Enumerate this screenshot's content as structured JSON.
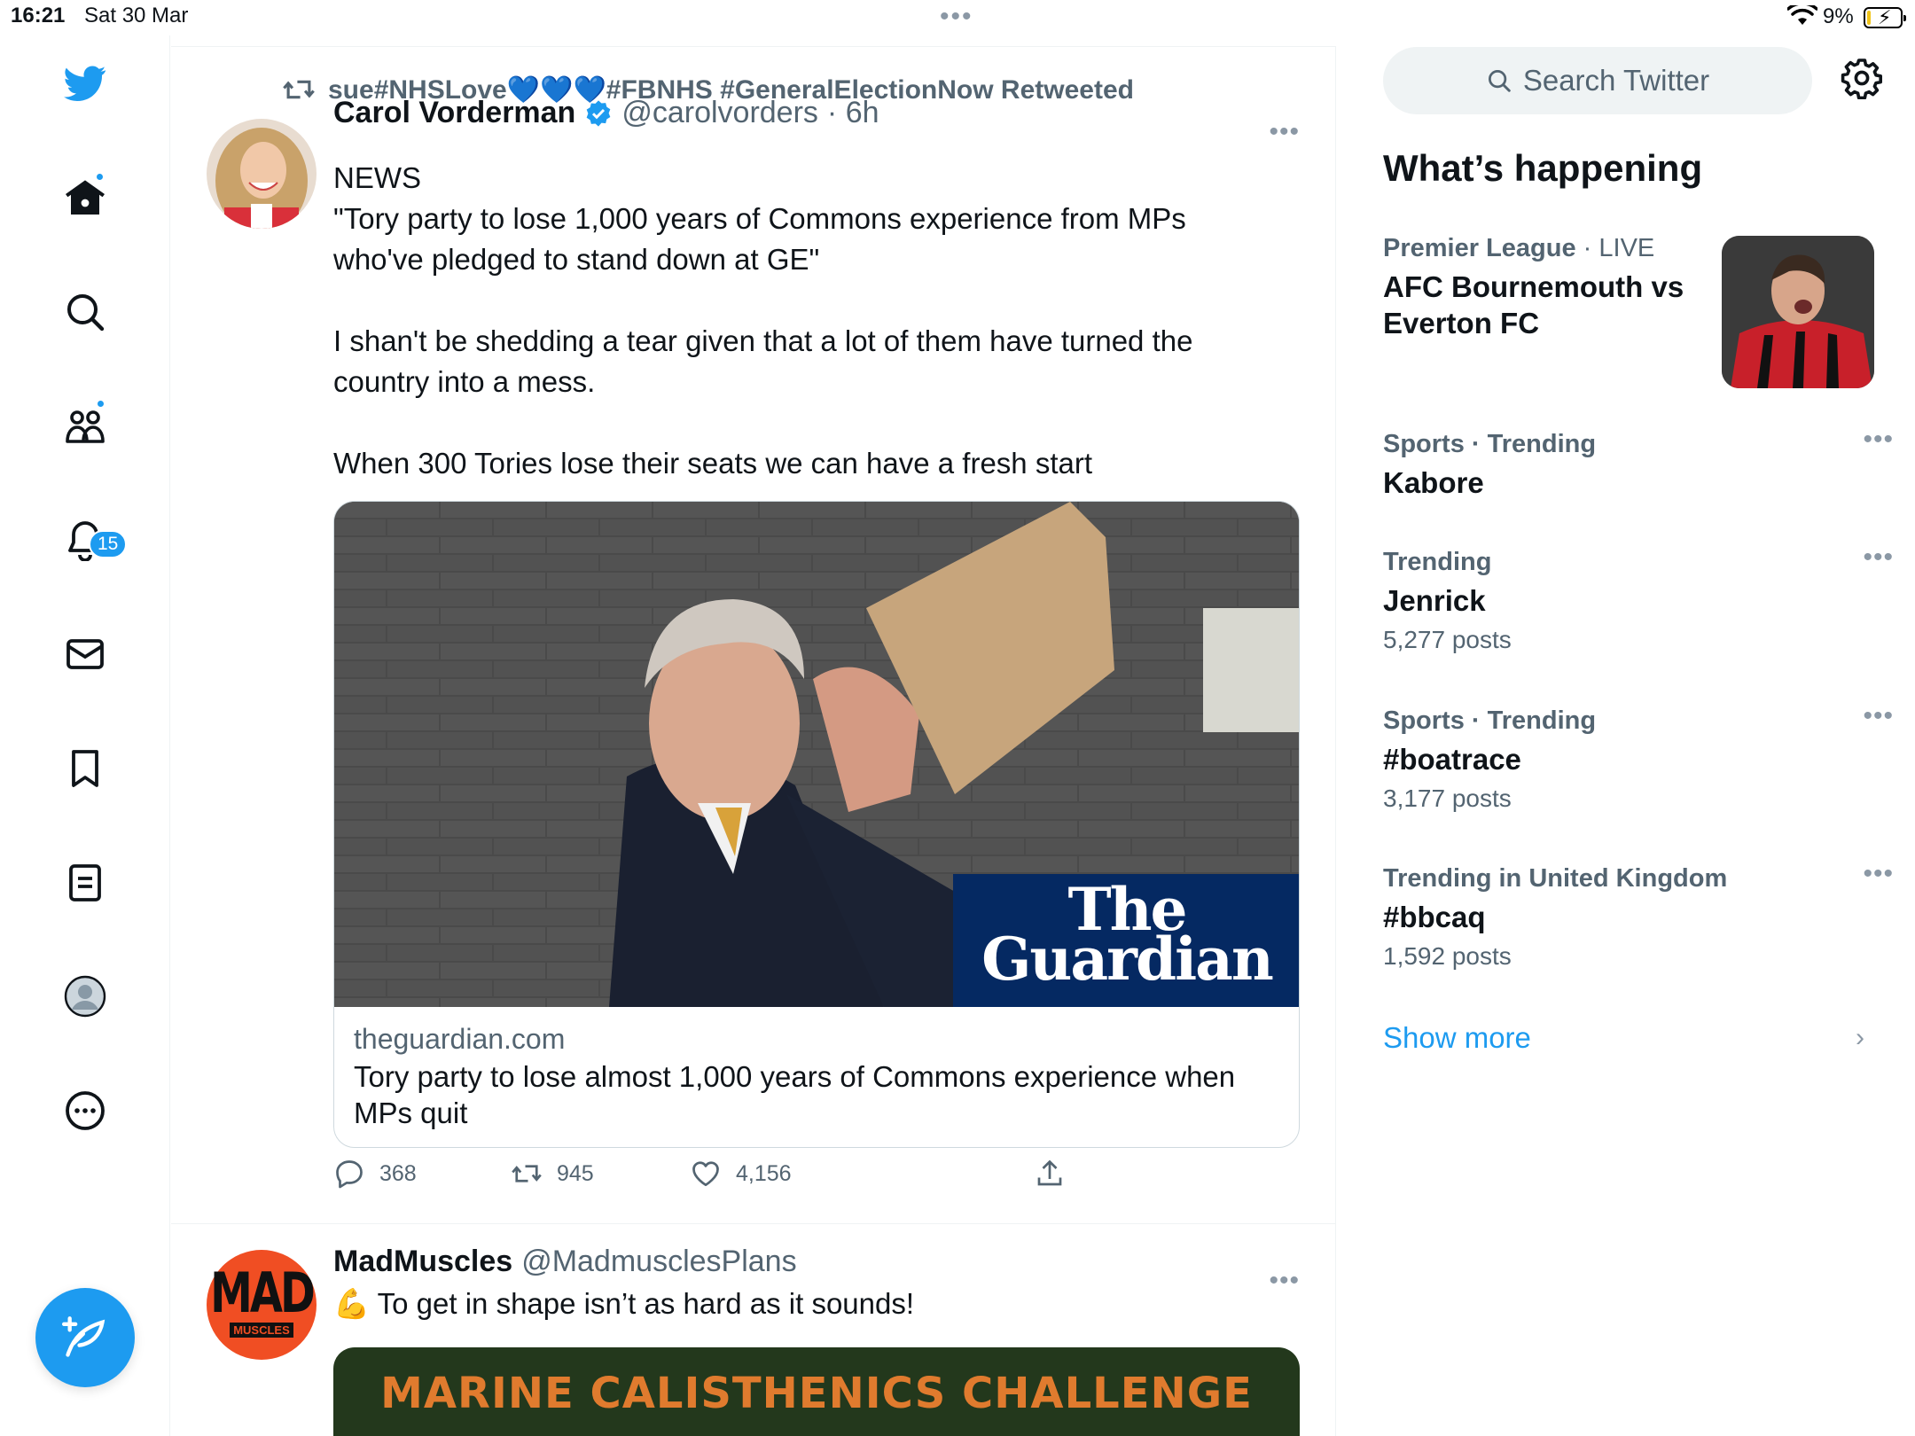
{
  "status_bar": {
    "time": "16:21",
    "date": "Sat 30 Mar",
    "battery_percent": "9%",
    "battery_level": 0.09
  },
  "nav": {
    "items": [
      "home",
      "explore",
      "communities",
      "notifications",
      "messages",
      "bookmarks",
      "lists",
      "profile",
      "more"
    ],
    "notifications_badge": "15"
  },
  "tweets": [
    {
      "retweeted_by": "sue#NHSLove💙💙💙#FBNHS #GeneralElectionNow Retweeted",
      "name": "Carol Vorderman",
      "handle": "@carolvorders",
      "time": "· 6h",
      "text": "NEWS\n\"Tory party to lose 1,000 years of Commons experience from MPs who've pledged to stand down at GE\"\n\nI shan't be shedding a tear given that a lot of them have turned the country into a mess.\n\nWhen 300 Tories lose their seats we can have a fresh start",
      "card": {
        "image_logo_line1": "The",
        "image_logo_line2": "Guardian",
        "domain": "theguardian.com",
        "title": "Tory party to lose almost 1,000 years of Commons experience when MPs quit"
      },
      "replies": "368",
      "retweets": "945",
      "likes": "4,156"
    },
    {
      "name": "MadMuscles",
      "handle": "@MadmusclesPlans",
      "avatar_text_top": "MAD",
      "avatar_text_bottom": "MUSCLES",
      "text": "💪 To get in shape isn’t as hard as it sounds!",
      "media_text": "MARINE CALISTHENICS CHALLENGE"
    }
  ],
  "sidebar": {
    "search_placeholder": "Search Twitter",
    "title": "What’s happening",
    "trends": [
      {
        "category": "Premier League",
        "suffix": " · LIVE",
        "topic": "AFC Bournemouth vs Everton FC",
        "count": ""
      },
      {
        "category": "Sports · Trending",
        "suffix": "",
        "topic": "Kabore",
        "count": ""
      },
      {
        "category": "Trending",
        "suffix": "",
        "topic": "Jenrick",
        "count": "5,277 posts"
      },
      {
        "category": "Sports · Trending",
        "suffix": "",
        "topic": "#boatrace",
        "count": "3,177 posts"
      },
      {
        "category": "Trending in United Kingdom",
        "suffix": "",
        "topic": "#bbcaq",
        "count": "1,592 posts"
      }
    ],
    "show_more": "Show more"
  },
  "colors": {
    "brand": "#1d9bf0",
    "text": "#0f1419",
    "secondary": "#536471",
    "guardian_blue": "#052962"
  }
}
